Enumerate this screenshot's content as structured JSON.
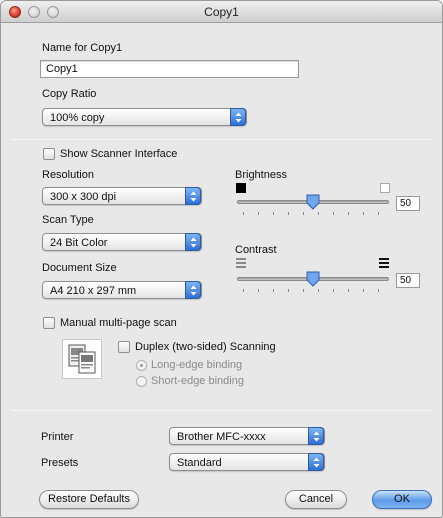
{
  "window": {
    "title": "Copy1"
  },
  "name": {
    "label": "Name for Copy1",
    "value": "Copy1"
  },
  "copy_ratio": {
    "label": "Copy Ratio",
    "value": "100% copy"
  },
  "scanner": {
    "show_interface_label": "Show Scanner Interface"
  },
  "resolution": {
    "label": "Resolution",
    "value": "300 x 300 dpi"
  },
  "scan_type": {
    "label": "Scan Type",
    "value": "24 Bit Color"
  },
  "document_size": {
    "label": "Document Size",
    "value": "A4  210 x 297 mm"
  },
  "brightness": {
    "label": "Brightness",
    "value": "50",
    "level": 0.5
  },
  "contrast": {
    "label": "Contrast",
    "value": "50",
    "level": 0.5
  },
  "manual_scan": {
    "label": "Manual multi-page scan"
  },
  "duplex": {
    "label": "Duplex (two-sided) Scanning",
    "long_edge": "Long-edge binding",
    "short_edge": "Short-edge binding",
    "selected": "long_edge"
  },
  "printer": {
    "label": "Printer",
    "value": "Brother MFC-xxxx"
  },
  "presets": {
    "label": "Presets",
    "value": "Standard"
  },
  "buttons": {
    "restore": "Restore Defaults",
    "cancel": "Cancel",
    "ok": "OK"
  },
  "colors": {
    "accent": "#3d7fe0",
    "window_bg": "#e8e8e8"
  }
}
